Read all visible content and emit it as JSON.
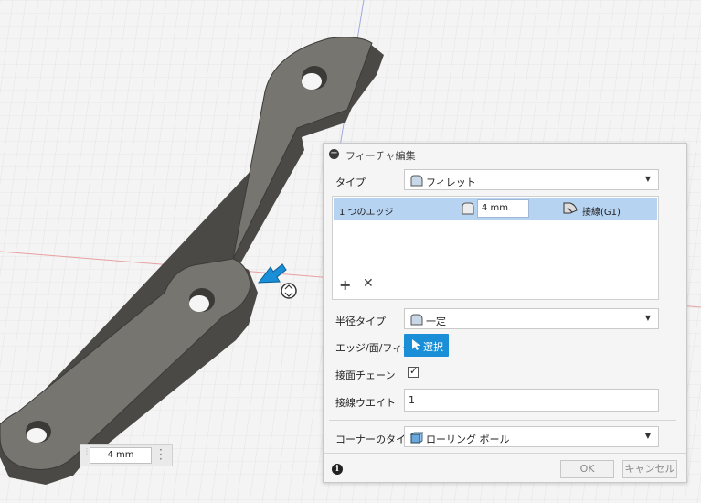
{
  "dialog": {
    "title": "フィーチャ編集",
    "type_label": "タイプ",
    "type_value": "フィレット",
    "edges": {
      "count_label": "1 つのエッジ",
      "radius_value": "4 mm",
      "tangency_value": "接線(G1)"
    },
    "radius_type_label": "半径タイプ",
    "radius_type_value": "一定",
    "selection_label": "エッジ/面/フィー...",
    "select_button": "選択",
    "tangent_chain_label": "接面チェーン",
    "tangent_chain_checked": true,
    "tangency_weight_label": "接線ウエイト",
    "tangency_weight_value": "1",
    "corner_type_label": "コーナーのタイプ",
    "corner_type_value": "ローリング ボール",
    "ok_label": "OK",
    "cancel_label": "キャンセル"
  },
  "canvas": {
    "dimension_value": "4 mm"
  },
  "colors": {
    "accent": "#1a8ed6",
    "selected_row": "#b7d3f2",
    "part_face": "#777570",
    "part_side": "#4a4945"
  }
}
